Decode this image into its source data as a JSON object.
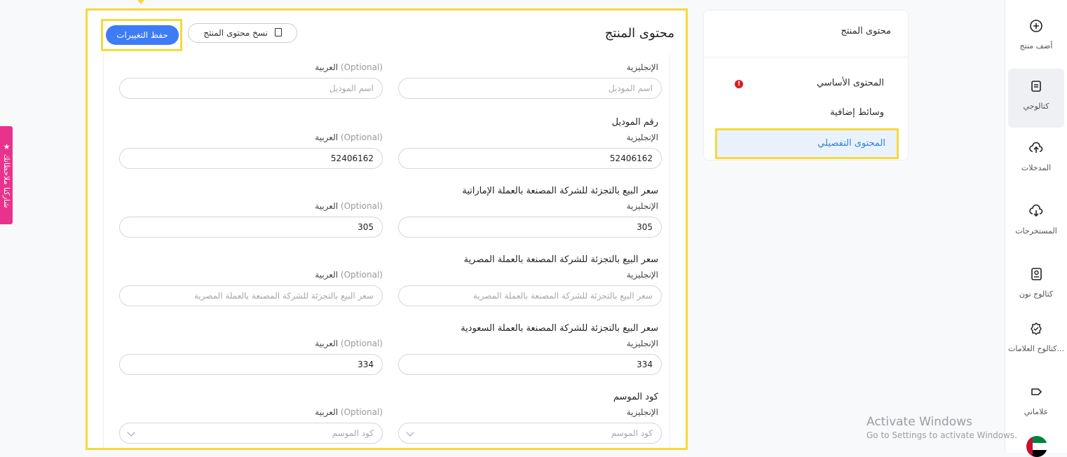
{
  "feedback_tab": "★ شاركنا ملاحظاتك",
  "nav": [
    {
      "label": "أضف منتج",
      "icon": "plus-circle-icon"
    },
    {
      "label": "كتالوجي",
      "icon": "catalog-icon",
      "active": true
    },
    {
      "label": "المدخلات",
      "icon": "cloud-upload-icon"
    },
    {
      "label": "المستخرجات",
      "icon": "cloud-download-icon"
    },
    {
      "label": "كتالوج نون",
      "icon": "noon-catalog-icon"
    },
    {
      "label": "كتالوج العلامات...",
      "icon": "badge-check-icon"
    },
    {
      "label": "علاماتي",
      "icon": "tag-icon"
    }
  ],
  "outline": {
    "title": "محتوى المنتج",
    "items": [
      "المحتوى الأساسي",
      "وسائط إضافية",
      "المحتوى التفصيلي"
    ],
    "active_index": 2,
    "error_on": 0
  },
  "main": {
    "title": "محتوى المنتج",
    "copy_button": "نسخ محتوى المنتج",
    "save_button": "حفظ التغييرات",
    "english_label": "الإنجليزية",
    "arabic_label": "العربية",
    "optional_label": "(Optional)",
    "sections": [
      {
        "title": "",
        "en_value": "",
        "en_placeholder": "اسم الموديل",
        "ar_value": "",
        "ar_placeholder": "اسم الموديل",
        "dropdown": false
      },
      {
        "title": "رقم الموديل",
        "en_value": "52406162",
        "en_placeholder": "",
        "ar_value": "52406162",
        "ar_placeholder": "",
        "dropdown": false
      },
      {
        "title": "سعر البيع بالتجزئة للشركة المصنعة بالعملة الإماراتية",
        "en_value": "305",
        "en_placeholder": "",
        "ar_value": "305",
        "ar_placeholder": "",
        "dropdown": false
      },
      {
        "title": "سعر البيع بالتجزئة للشركة المصنعة بالعملة المصرية",
        "en_value": "",
        "en_placeholder": "سعر البيع بالتجزئة للشركة المصنعة بالعملة المصرية",
        "ar_value": "",
        "ar_placeholder": "سعر البيع بالتجزئة للشركة المصنعة بالعملة المصرية",
        "dropdown": false
      },
      {
        "title": "سعر البيع بالتجزئة للشركة المصنعة بالعملة السعودية",
        "en_value": "334",
        "en_placeholder": "",
        "ar_value": "334",
        "ar_placeholder": "",
        "dropdown": false
      },
      {
        "title": "كود الموسم",
        "en_value": "",
        "en_placeholder": "كود الموسم",
        "ar_value": "",
        "ar_placeholder": "كود الموسم",
        "dropdown": true
      }
    ]
  },
  "watermark": {
    "line1": "Activate Windows",
    "line2": "Go to Settings to activate Windows."
  }
}
